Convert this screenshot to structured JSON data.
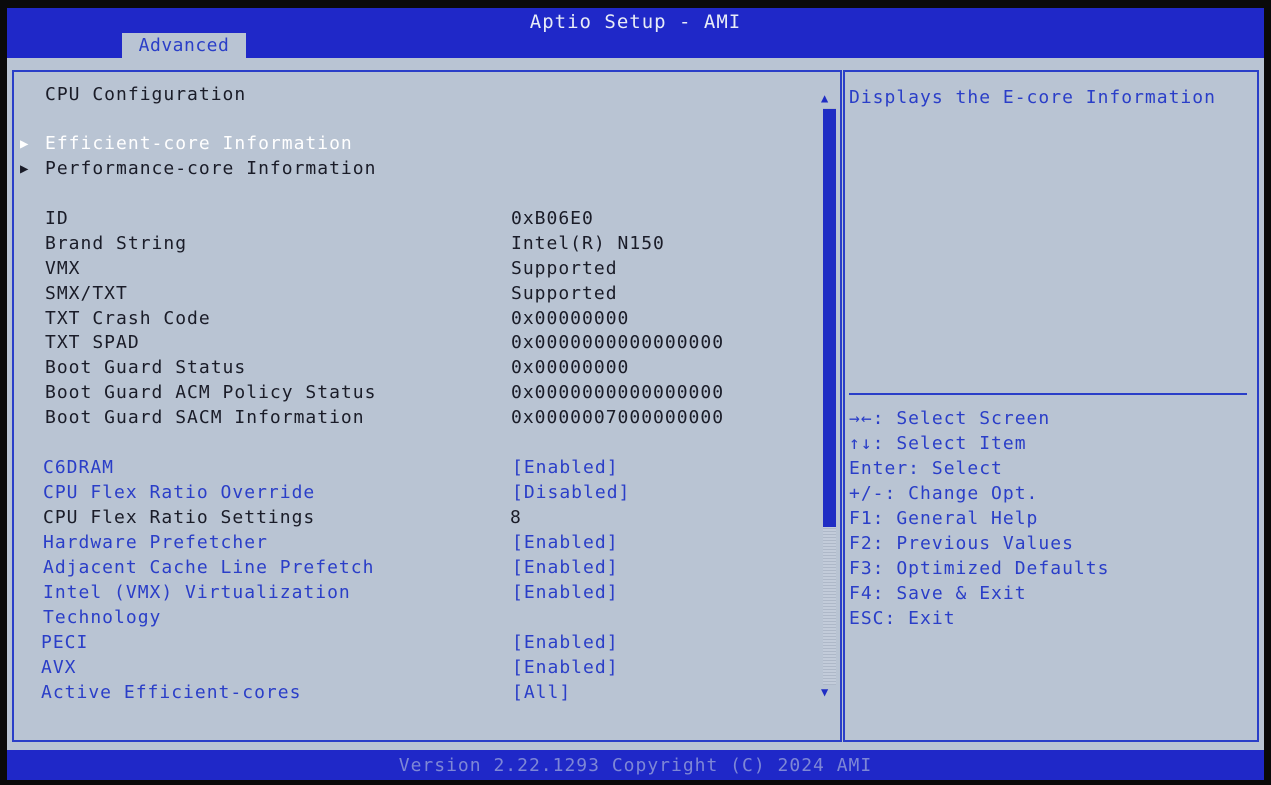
{
  "header": {
    "title": "Aptio Setup - AMI",
    "tab": "Advanced"
  },
  "main": {
    "section_title": "CPU Configuration",
    "submenus": [
      {
        "label": "Efficient-core Information",
        "selected": true
      },
      {
        "label": "Performance-core Information",
        "selected": false
      }
    ],
    "info": [
      {
        "label": "ID",
        "value": "0xB06E0"
      },
      {
        "label": "Brand String",
        "value": "Intel(R) N150"
      },
      {
        "label": "VMX",
        "value": "Supported"
      },
      {
        "label": "SMX/TXT",
        "value": "Supported"
      },
      {
        "label": "TXT Crash Code",
        "value": "0x00000000"
      },
      {
        "label": "TXT SPAD",
        "value": "0x0000000000000000"
      },
      {
        "label": "Boot Guard Status",
        "value": "0x00000000"
      },
      {
        "label": "Boot Guard ACM Policy Status",
        "value": "0x0000000000000000"
      },
      {
        "label": "Boot Guard SACM Information",
        "value": "0x0000007000000000"
      }
    ],
    "options": [
      {
        "label": "C6DRAM",
        "value": "[Enabled]",
        "editable": true
      },
      {
        "label": "CPU Flex Ratio Override",
        "value": "[Disabled]",
        "editable": true
      },
      {
        "label": "CPU Flex Ratio Settings",
        "value": "8",
        "editable": false
      },
      {
        "label": "Hardware Prefetcher",
        "value": "[Enabled]",
        "editable": true
      },
      {
        "label": "Adjacent Cache Line Prefetch",
        "value": "[Enabled]",
        "editable": true
      },
      {
        "label": "Intel (VMX) Virtualization",
        "label2": "Technology",
        "value": "[Enabled]",
        "editable": true
      },
      {
        "label": "PECI",
        "value": "[Enabled]",
        "editable": true
      },
      {
        "label": "AVX",
        "value": "[Enabled]",
        "editable": true
      },
      {
        "label": "Active Efficient-cores",
        "value": "[All]",
        "editable": true
      }
    ]
  },
  "help": {
    "description": "Displays the E-core Information",
    "keys": [
      "→←: Select Screen",
      "↑↓: Select Item",
      "Enter: Select",
      "+/-: Change Opt.",
      "F1: General Help",
      "F2: Previous Values",
      "F3: Optimized Defaults",
      "F4: Save & Exit",
      "ESC: Exit"
    ]
  },
  "footer": {
    "text": "Version 2.22.1293 Copyright (C) 2024 AMI"
  },
  "colors": {
    "background": "#b9c4d3",
    "header": "#1f28c8",
    "accent": "#2a3ec8",
    "text": "#1a1c28",
    "selected": "#ffffff"
  }
}
